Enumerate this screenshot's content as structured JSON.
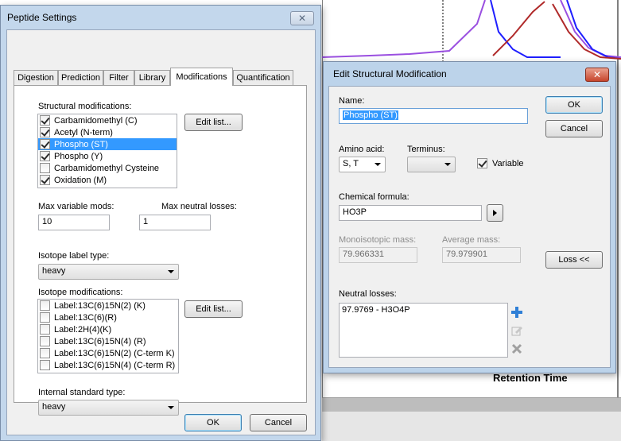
{
  "background": {
    "x_axis_label": "Retention Time",
    "series_colors": [
      "#9a4fe0",
      "#1f1fff",
      "#b02a2a"
    ]
  },
  "peptide_settings": {
    "title": "Peptide Settings",
    "close_glyph": "✕",
    "tabs": [
      "Digestion",
      "Prediction",
      "Filter",
      "Library",
      "Modifications",
      "Quantification"
    ],
    "active_tab": "Modifications",
    "structural_label": "Structural modifications:",
    "structural_mods": [
      {
        "label": "Carbamidomethyl (C)",
        "checked": true,
        "selected": false
      },
      {
        "label": "Acetyl (N-term)",
        "checked": true,
        "selected": false
      },
      {
        "label": "Phospho (ST)",
        "checked": true,
        "selected": true
      },
      {
        "label": "Phospho (Y)",
        "checked": true,
        "selected": false
      },
      {
        "label": "Carbamidomethyl Cysteine",
        "checked": false,
        "selected": false
      },
      {
        "label": "Oxidation (M)",
        "checked": true,
        "selected": false
      }
    ],
    "edit_list_label": "Edit list...",
    "max_variable_label": "Max variable mods:",
    "max_variable_value": "10",
    "max_neutral_label": "Max neutral losses:",
    "max_neutral_value": "1",
    "isotope_label_type_label": "Isotope label type:",
    "isotope_label_type_value": "heavy",
    "isotope_mods_label": "Isotope modifications:",
    "isotope_mods": [
      {
        "label": "Label:13C(6)15N(2) (K)",
        "checked": false
      },
      {
        "label": "Label:13C(6)(R)",
        "checked": false
      },
      {
        "label": "Label:2H(4)(K)",
        "checked": false
      },
      {
        "label": "Label:13C(6)15N(4) (R)",
        "checked": false
      },
      {
        "label": "Label:13C(6)15N(2) (C-term K)",
        "checked": false
      },
      {
        "label": "Label:13C(6)15N(4) (C-term R)",
        "checked": false
      }
    ],
    "edit_list2_label": "Edit list...",
    "internal_standard_label": "Internal standard type:",
    "internal_standard_value": "heavy",
    "ok_label": "OK",
    "cancel_label": "Cancel"
  },
  "edit_mod": {
    "title": "Edit Structural Modification",
    "close_glyph": "✕",
    "name_label": "Name:",
    "name_value": "Phospho (ST)",
    "ok_label": "OK",
    "cancel_label": "Cancel",
    "amino_acid_label": "Amino acid:",
    "amino_acid_value": "S, T",
    "terminus_label": "Terminus:",
    "terminus_value": "",
    "variable_label": "Variable",
    "variable_checked": true,
    "formula_label": "Chemical formula:",
    "formula_value": "HO3P",
    "mono_label": "Monoisotopic mass:",
    "mono_value": "79.966331",
    "avg_label": "Average mass:",
    "avg_value": "79.979901",
    "loss_button_label": "Loss <<",
    "neutral_losses_label": "Neutral losses:",
    "neutral_losses": [
      "97.9769 - H3O4P"
    ]
  }
}
